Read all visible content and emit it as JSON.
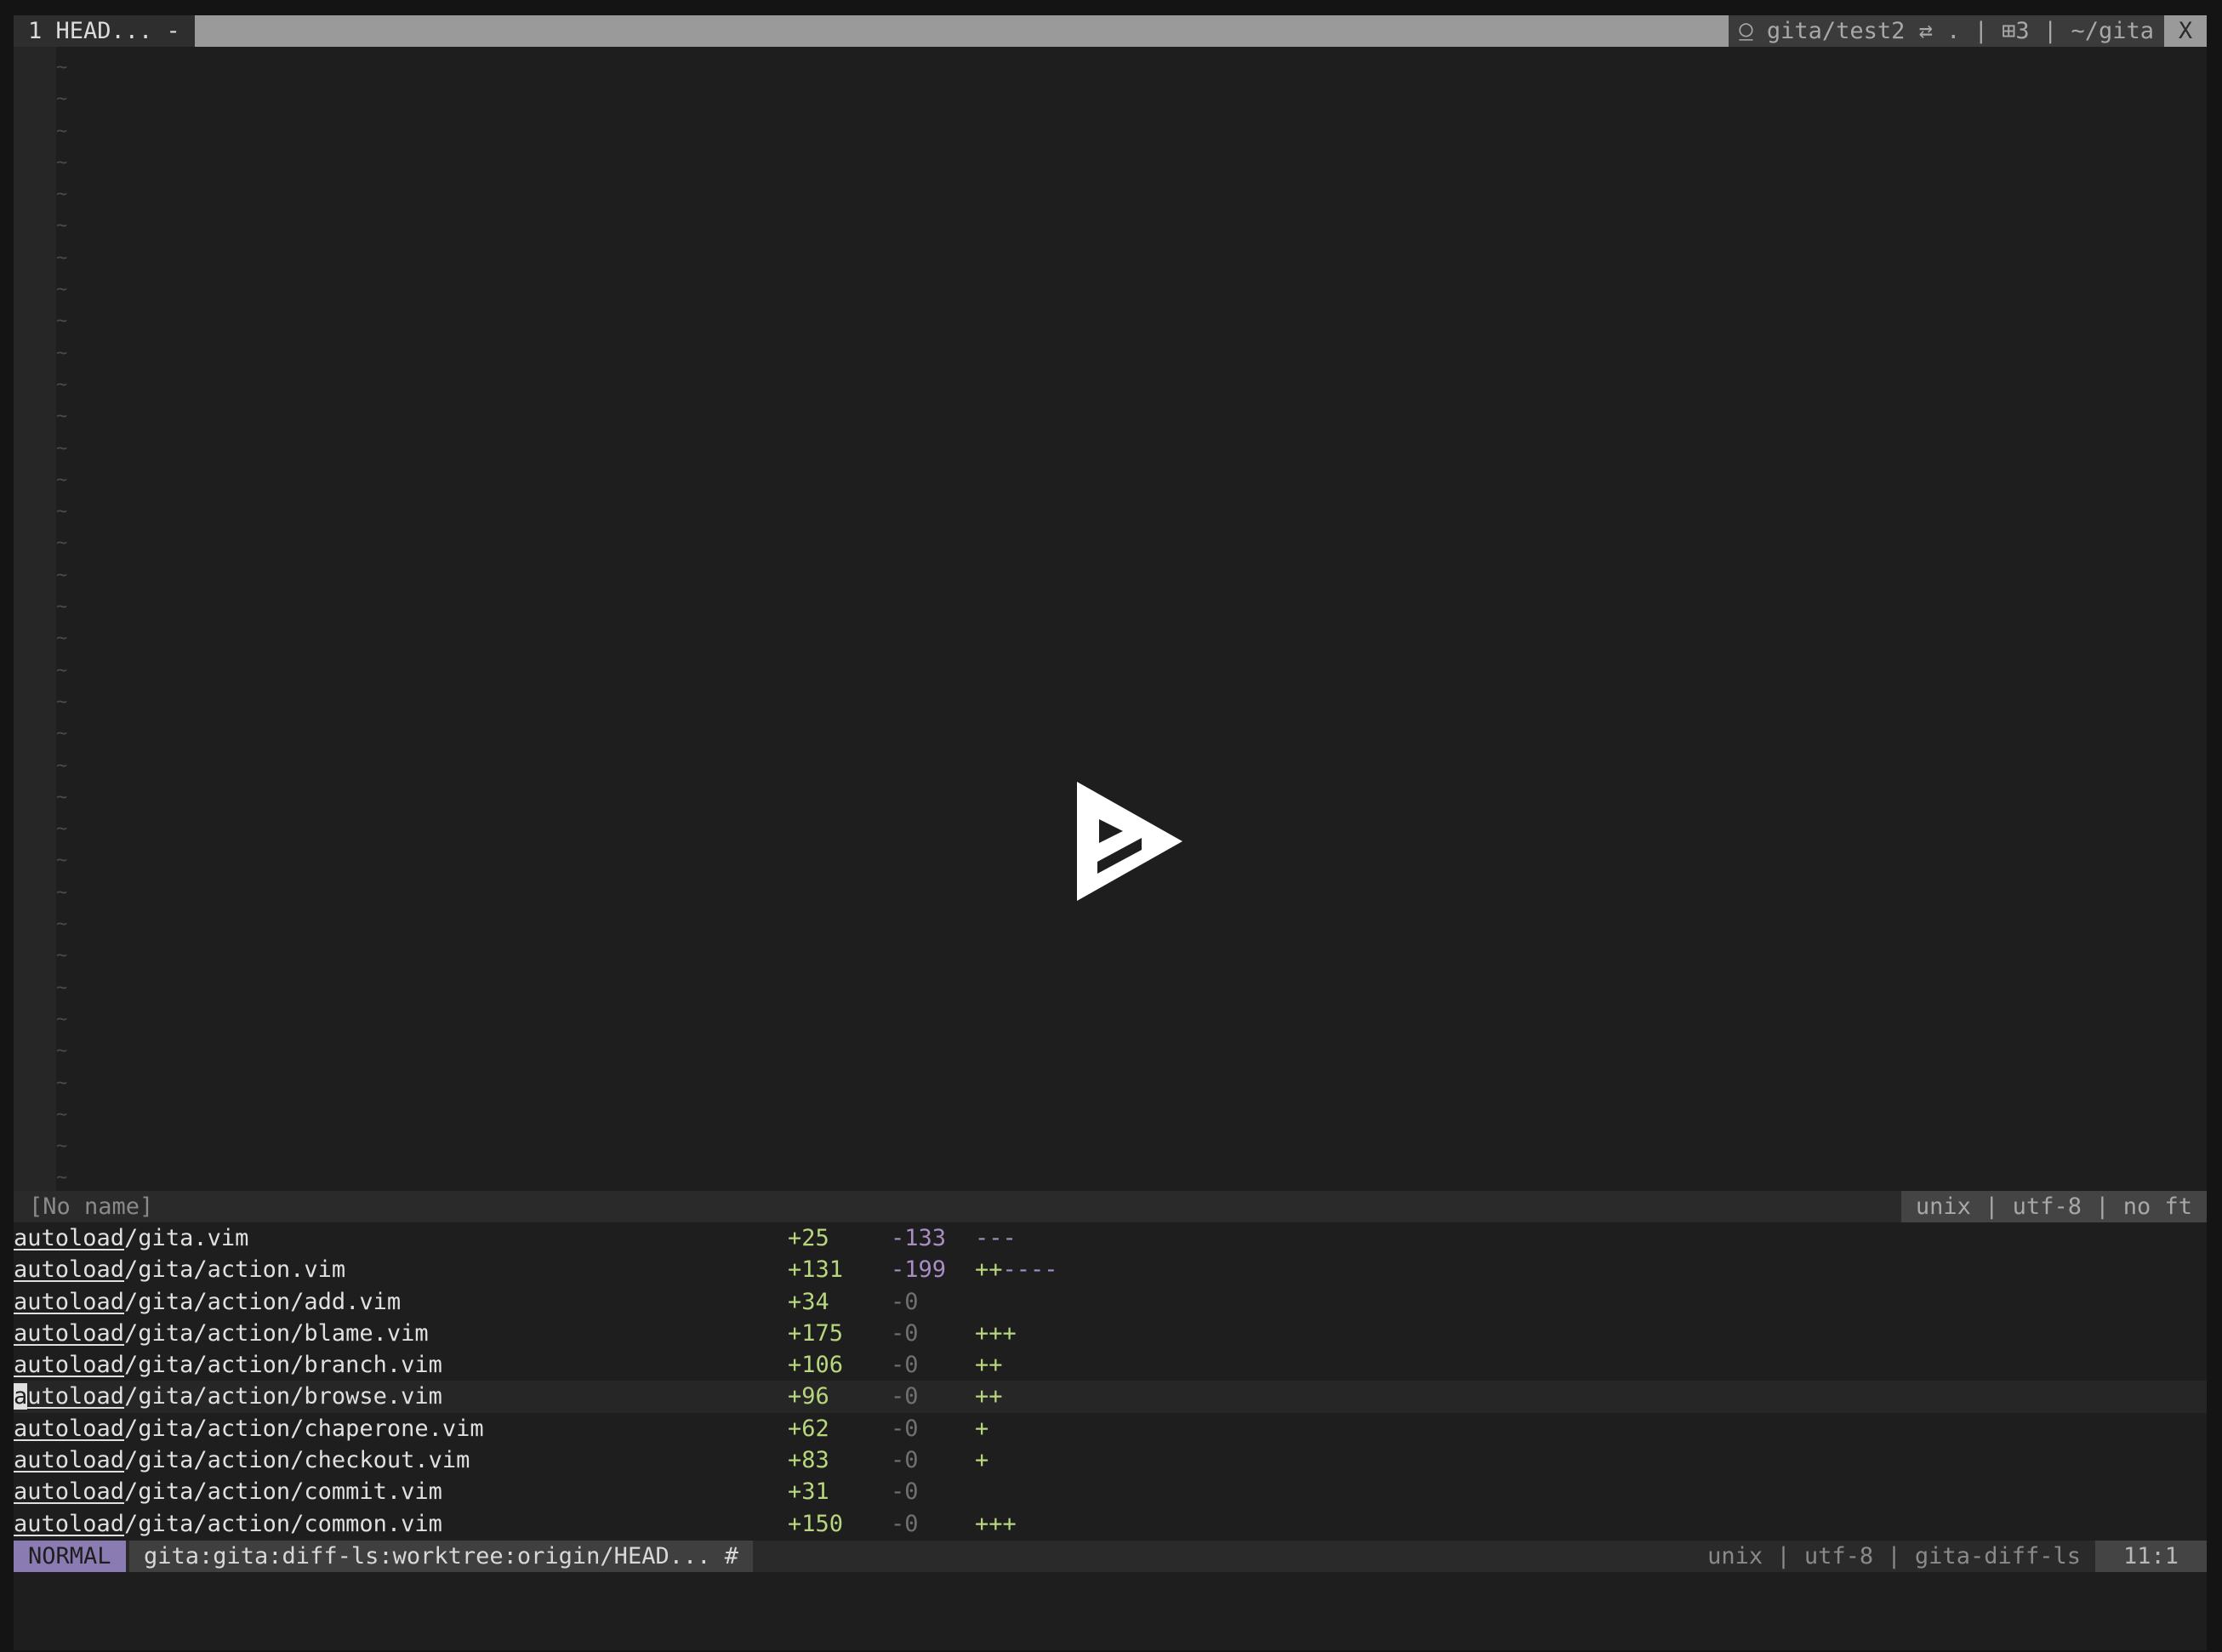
{
  "tabline": {
    "current_tab": "1 HEAD... -",
    "right_info": "⍜ gita/test2 ⇄ . | ⊞3 | ~/gita",
    "close": "X"
  },
  "upper_window": {
    "status_name": "[No name]",
    "status_info": "unix | utf-8 | no ft",
    "empty_line_marker": "~",
    "empty_line_count": 36,
    "play_icon": "play-triangle-icon"
  },
  "diff_ls": {
    "rows": [
      {
        "dir": "autoload",
        "rest": "/gita.vim",
        "add": "+25",
        "del": "-133",
        "plus_bar": "",
        "minus_bar": "---"
      },
      {
        "dir": "autoload",
        "rest": "/gita/action.vim",
        "add": "+131",
        "del": "-199",
        "plus_bar": "++",
        "minus_bar": "----"
      },
      {
        "dir": "autoload",
        "rest": "/gita/action/add.vim",
        "add": "+34",
        "del": "-0",
        "plus_bar": "",
        "minus_bar": ""
      },
      {
        "dir": "autoload",
        "rest": "/gita/action/blame.vim",
        "add": "+175",
        "del": "-0",
        "plus_bar": "+++",
        "minus_bar": ""
      },
      {
        "dir": "autoload",
        "rest": "/gita/action/branch.vim",
        "add": "+106",
        "del": "-0",
        "plus_bar": "++",
        "minus_bar": ""
      },
      {
        "dir": "autoload",
        "rest": "/gita/action/browse.vim",
        "add": "+96",
        "del": "-0",
        "plus_bar": "++",
        "minus_bar": "",
        "cursor": true
      },
      {
        "dir": "autoload",
        "rest": "/gita/action/chaperone.vim",
        "add": "+62",
        "del": "-0",
        "plus_bar": "+",
        "minus_bar": ""
      },
      {
        "dir": "autoload",
        "rest": "/gita/action/checkout.vim",
        "add": "+83",
        "del": "-0",
        "plus_bar": "+",
        "minus_bar": ""
      },
      {
        "dir": "autoload",
        "rest": "/gita/action/commit.vim",
        "add": "+31",
        "del": "-0",
        "plus_bar": "",
        "minus_bar": ""
      },
      {
        "dir": "autoload",
        "rest": "/gita/action/common.vim",
        "add": "+150",
        "del": "-0",
        "plus_bar": "+++",
        "minus_bar": ""
      }
    ]
  },
  "lower_status": {
    "mode": "NORMAL",
    "buffer_name": "gita:gita:diff-ls:worktree:origin/HEAD... #",
    "info": "unix | utf-8 | gita-diff-ls",
    "position": "11:1"
  },
  "colors": {
    "background": "#1e1e1e",
    "added": "#b8d67e",
    "removed": "#a88ec4",
    "zero": "#707070",
    "mode_bg": "#8a7cb2"
  }
}
